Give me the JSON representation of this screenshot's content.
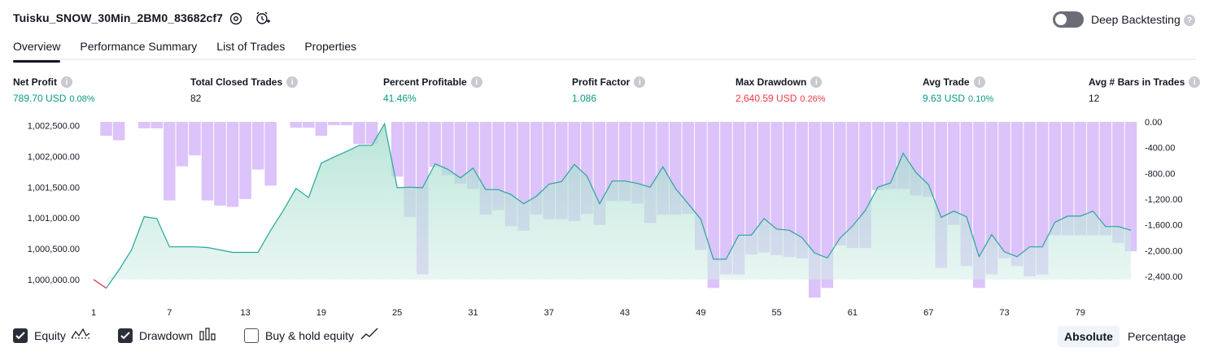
{
  "header": {
    "strategy_name": "Tuisku_SNOW_30Min_2BM0_83682cf7",
    "deep_backtesting_label": "Deep Backtesting",
    "help_glyph": "?"
  },
  "tabs": [
    "Overview",
    "Performance Summary",
    "List of Trades",
    "Properties"
  ],
  "metrics": [
    {
      "label": "Net Profit",
      "value": "789.70 USD",
      "pct": "0.08%",
      "color": "green"
    },
    {
      "label": "Total Closed Trades",
      "value": "82",
      "pct": "",
      "color": "neutral"
    },
    {
      "label": "Percent Profitable",
      "value": "41.46%",
      "pct": "",
      "color": "green"
    },
    {
      "label": "Profit Factor",
      "value": "1.086",
      "pct": "",
      "color": "green"
    },
    {
      "label": "Max Drawdown",
      "value": "2,640.59 USD",
      "pct": "0.26%",
      "color": "red"
    },
    {
      "label": "Avg Trade",
      "value": "9.63 USD",
      "pct": "0.10%",
      "color": "green"
    },
    {
      "label": "Avg # Bars in Trades",
      "value": "12",
      "pct": "",
      "color": "neutral"
    }
  ],
  "legend": {
    "equity": "Equity",
    "drawdown": "Drawdown",
    "buy_hold": "Buy & hold equity"
  },
  "view_toggle": {
    "absolute": "Absolute",
    "percentage": "Percentage"
  },
  "colors": {
    "equity_line": "#26a69a",
    "equity_loss": "#f23645",
    "equity_fill": "#d5efe8",
    "drawdown_bar": "#dcc3f9",
    "accent_green": "#089981",
    "accent_red": "#f23645"
  },
  "chart_data": {
    "type": "area",
    "x_ticks": [
      "1",
      "7",
      "13",
      "19",
      "25",
      "31",
      "37",
      "43",
      "49",
      "55",
      "61",
      "67",
      "73",
      "79"
    ],
    "left_axis": {
      "ticks": [
        "1,002,500.00",
        "1,002,000.00",
        "1,001,500.00",
        "1,001,000.00",
        "1,000,500.00",
        "1,000,000.00"
      ],
      "range": [
        999800,
        1002560
      ]
    },
    "right_axis": {
      "ticks": [
        "0.00",
        "-400.00",
        "-800.00",
        "-1,200.00",
        "-1,600.00",
        "-2,000.00",
        "-2,400.00"
      ],
      "range": [
        -2640,
        0
      ]
    },
    "series": [
      {
        "name": "Equity",
        "x": [
          1,
          2,
          3,
          4,
          5,
          6,
          7,
          8,
          9,
          10,
          11,
          12,
          13,
          14,
          15,
          16,
          17,
          18,
          19,
          20,
          21,
          22,
          23,
          24,
          25,
          26,
          27,
          28,
          29,
          30,
          31,
          32,
          33,
          34,
          35,
          36,
          37,
          38,
          39,
          40,
          41,
          42,
          43,
          44,
          45,
          46,
          47,
          48,
          49,
          50,
          51,
          52,
          53,
          54,
          55,
          56,
          57,
          58,
          59,
          60,
          61,
          62,
          63,
          64,
          65,
          66,
          67,
          68,
          69,
          70,
          71,
          72,
          73,
          74,
          75,
          76,
          77,
          78,
          79,
          80,
          81,
          82,
          83
        ],
        "values": [
          1000000,
          999860,
          1000150,
          1000480,
          1001020,
          1000990,
          1000530,
          1000530,
          1000530,
          1000520,
          1000480,
          1000440,
          1000440,
          1000440,
          1000800,
          1001120,
          1001480,
          1001330,
          1001890,
          1001990,
          1002080,
          1002180,
          1002180,
          1002530,
          1001490,
          1001500,
          1001490,
          1001880,
          1001790,
          1001650,
          1001810,
          1001460,
          1001460,
          1001380,
          1001230,
          1001350,
          1001550,
          1001590,
          1001870,
          1001680,
          1001230,
          1001600,
          1001600,
          1001560,
          1001500,
          1001830,
          1001480,
          1001230,
          1000980,
          1000330,
          1000330,
          1000720,
          1000720,
          1000990,
          1000820,
          1000800,
          1000680,
          1000430,
          1000350,
          1000670,
          1000870,
          1001120,
          1001500,
          1001570,
          1002050,
          1001740,
          1001540,
          1001010,
          1001110,
          1001020,
          1000370,
          1000730,
          1000450,
          1000370,
          1000530,
          1000530,
          1000930,
          1001030,
          1001030,
          1001110,
          1000860,
          1000860,
          1000800
        ]
      },
      {
        "name": "Drawdown",
        "x": [
          1,
          2,
          3,
          4,
          5,
          6,
          7,
          8,
          9,
          10,
          11,
          12,
          13,
          14,
          15,
          16,
          17,
          18,
          19,
          20,
          21,
          22,
          23,
          24,
          25,
          26,
          27,
          28,
          29,
          30,
          31,
          32,
          33,
          34,
          35,
          36,
          37,
          38,
          39,
          40,
          41,
          42,
          43,
          44,
          45,
          46,
          47,
          48,
          49,
          50,
          51,
          52,
          53,
          54,
          55,
          56,
          57,
          58,
          59,
          60,
          61,
          62,
          63,
          64,
          65,
          66,
          67,
          68,
          69,
          70,
          71,
          72,
          73,
          74,
          75,
          76,
          77,
          78,
          79,
          80,
          81,
          82,
          83
        ],
        "values": [
          0,
          -215,
          -285,
          0,
          -100,
          -100,
          -1220,
          -690,
          -520,
          -1220,
          -1300,
          -1320,
          -1200,
          -740,
          -990,
          0,
          -90,
          -90,
          -215,
          -50,
          -50,
          -345,
          -345,
          0,
          -850,
          -1480,
          -2370,
          -700,
          -830,
          -960,
          -1040,
          -1440,
          -1370,
          -1620,
          -1690,
          -1440,
          -1510,
          -1510,
          -1540,
          -1430,
          -1600,
          -1230,
          -1230,
          -1270,
          -1570,
          -1440,
          -1440,
          -1430,
          -1990,
          -2580,
          -2370,
          -2370,
          -2060,
          -2030,
          -2070,
          -2100,
          -2120,
          -2730,
          -2580,
          -1920,
          -1960,
          -1960,
          -1060,
          -1040,
          -1040,
          -1140,
          -1160,
          -2270,
          -1600,
          -2240,
          -2580,
          -2370,
          -2120,
          -2240,
          -2400,
          -2370,
          -1760,
          -1760,
          -1760,
          -1760,
          -1760,
          -1880,
          -2010
        ]
      }
    ],
    "grid": false,
    "legend_position": "bottom-left"
  }
}
